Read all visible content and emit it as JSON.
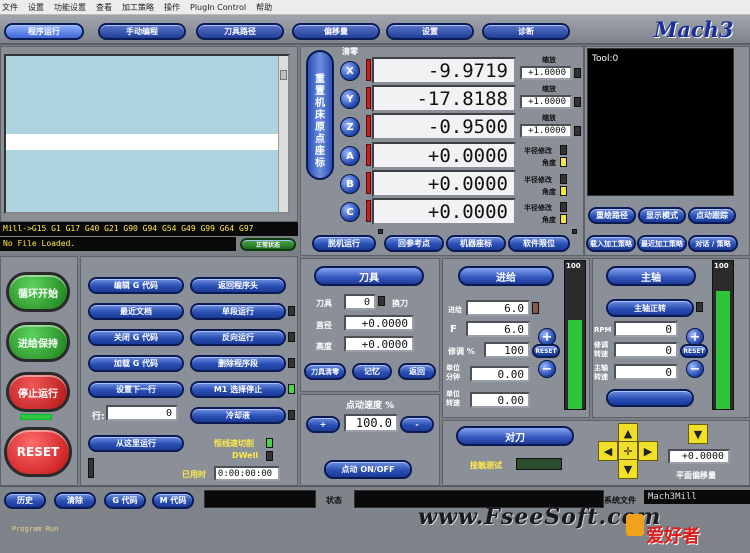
{
  "menu": [
    "文件",
    "设置",
    "功能设置",
    "查看",
    "加工策略",
    "操作",
    "PlugIn Control",
    "帮助"
  ],
  "tabs": [
    "程序运行",
    "手动编程",
    "刀具路径",
    "偏移量",
    "设置",
    "诊断"
  ],
  "logo": "Mach3",
  "dro": {
    "zero_label": "清零",
    "reset_coord_label": "重置机床原点座标",
    "axes": [
      {
        "name": "X",
        "value": "-9.9719",
        "scale_label": "缩放",
        "scale": "+1.0000"
      },
      {
        "name": "Y",
        "value": "-17.8188",
        "scale_label": "缩放",
        "scale": "+1.0000"
      },
      {
        "name": "Z",
        "value": "-0.9500",
        "scale_label": "缩放",
        "scale": "+1.0000"
      },
      {
        "name": "A",
        "value": "+0.0000",
        "extra1": "半径修改",
        "extra2": "角度"
      },
      {
        "name": "B",
        "value": "+0.0000",
        "extra1": "半径修改",
        "extra2": "角度"
      },
      {
        "name": "C",
        "value": "+0.0000",
        "extra1": "半径修改",
        "extra2": "角度"
      }
    ],
    "buttons": [
      "脱机运行",
      "回参考点",
      "机器座标",
      "软件限位"
    ]
  },
  "tool_label": "Tool:0",
  "right_buttons": [
    "重绘路径",
    "显示模式",
    "点动跟踪",
    "载入加工策略",
    "最近加工策略",
    "对话 / 策略"
  ],
  "gcode_line": "Mill->G15  G1 G17 G40 G21 G90 G94 G54 G49 G99 G64 G97",
  "file_status": "No File Loaded.",
  "file_status_btn": "正常状态",
  "big_buttons": {
    "cycle_start": "循环开始",
    "feed_hold": "进给保持",
    "stop": "停止运行",
    "reset": "RESET"
  },
  "program_buttons_left": [
    "编辑 G 代码",
    "最近文档",
    "关闭 G 代码",
    "加载 G 代码",
    "设置下一行"
  ],
  "program_buttons_right": [
    "返回程序头",
    "单段运行",
    "反向运行",
    "删除程序段",
    "M1 选择停止",
    "冷却液"
  ],
  "line_label": "行:",
  "line_value": "0",
  "run_from_here": "从这里运行",
  "const_vel": "恒线速切削",
  "dwell": "DWell",
  "elapsed_label": "已用时",
  "elapsed": "0:00:00:00",
  "tool": {
    "title": "刀具",
    "tool_label": "刀具",
    "tool_value": "0",
    "change": "换刀",
    "dia_label": "直径",
    "dia_value": "+0.0000",
    "height_label": "高度",
    "height_value": "+0.0000",
    "zero_btn": "刀具清零",
    "remember_btn": "记忆",
    "return_btn": "返回"
  },
  "jog": {
    "title": "点动速度 %",
    "plus": "+",
    "minus": "-",
    "value": "100.0",
    "on_off": "点动 ON/OFF"
  },
  "feed": {
    "title": "进给",
    "sro_max": "100",
    "feed_label": "进给",
    "feed_value": "6.0",
    "f_label": "F",
    "f_value": "6.0",
    "ovr_label": "修调 %",
    "ovr_value": "100",
    "unit_min_label": "单位 分钟",
    "unit_min_value": "0.00",
    "unit_rev_label": "单位 转速",
    "unit_rev_value": "0.00",
    "reset": "RESET"
  },
  "spindle": {
    "title": "主轴",
    "max": "100",
    "forward": "主轴正转",
    "rpm_label": "RPM",
    "rpm_value": "0",
    "ovr_label": "修调 转速",
    "ovr_value": "0",
    "spindle_label": "主轴 转速",
    "spindle_value": "0"
  },
  "toolset": {
    "title": "对刀",
    "touch": "接触测试",
    "plane_offset": "平面偏移量",
    "offset_value": "+0.0000"
  },
  "bottom": {
    "history": "历史",
    "clear": "清除",
    "gcodes": "G 代码",
    "mcodes": "M 代码",
    "status_label": "状态",
    "profile_label": "系统文件",
    "profile": "Mach3Mill",
    "program_run": "Program Run",
    "watermark": "www.FseeSoft.com",
    "brand": "爱好者"
  }
}
